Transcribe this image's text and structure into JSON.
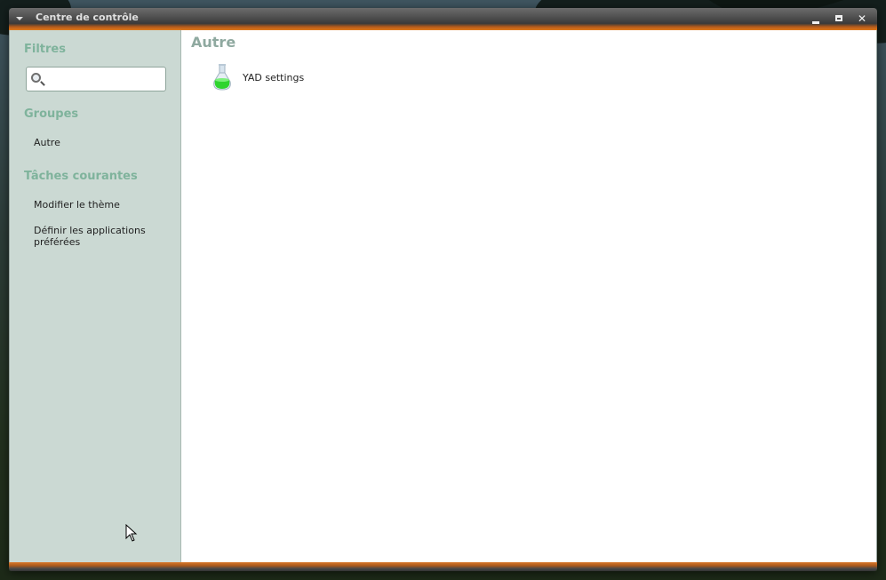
{
  "window": {
    "title": "Centre de contrôle"
  },
  "sidebar": {
    "filters_heading": "Filtres",
    "search": {
      "value": "",
      "placeholder": ""
    },
    "groups_heading": "Groupes",
    "groups": [
      {
        "label": "Autre"
      }
    ],
    "tasks_heading": "Tâches courantes",
    "tasks": [
      {
        "label": "Modifier le thème"
      },
      {
        "label_line1": "Définir les applications",
        "label_line2": "préférées"
      }
    ]
  },
  "main": {
    "heading": "Autre",
    "items": [
      {
        "label": "YAD settings",
        "icon": "flask-icon"
      }
    ]
  },
  "colors": {
    "accent_orange": "#e07a1c",
    "sidebar_bg": "#cbd9d3",
    "heading_green": "#7fb39c"
  }
}
